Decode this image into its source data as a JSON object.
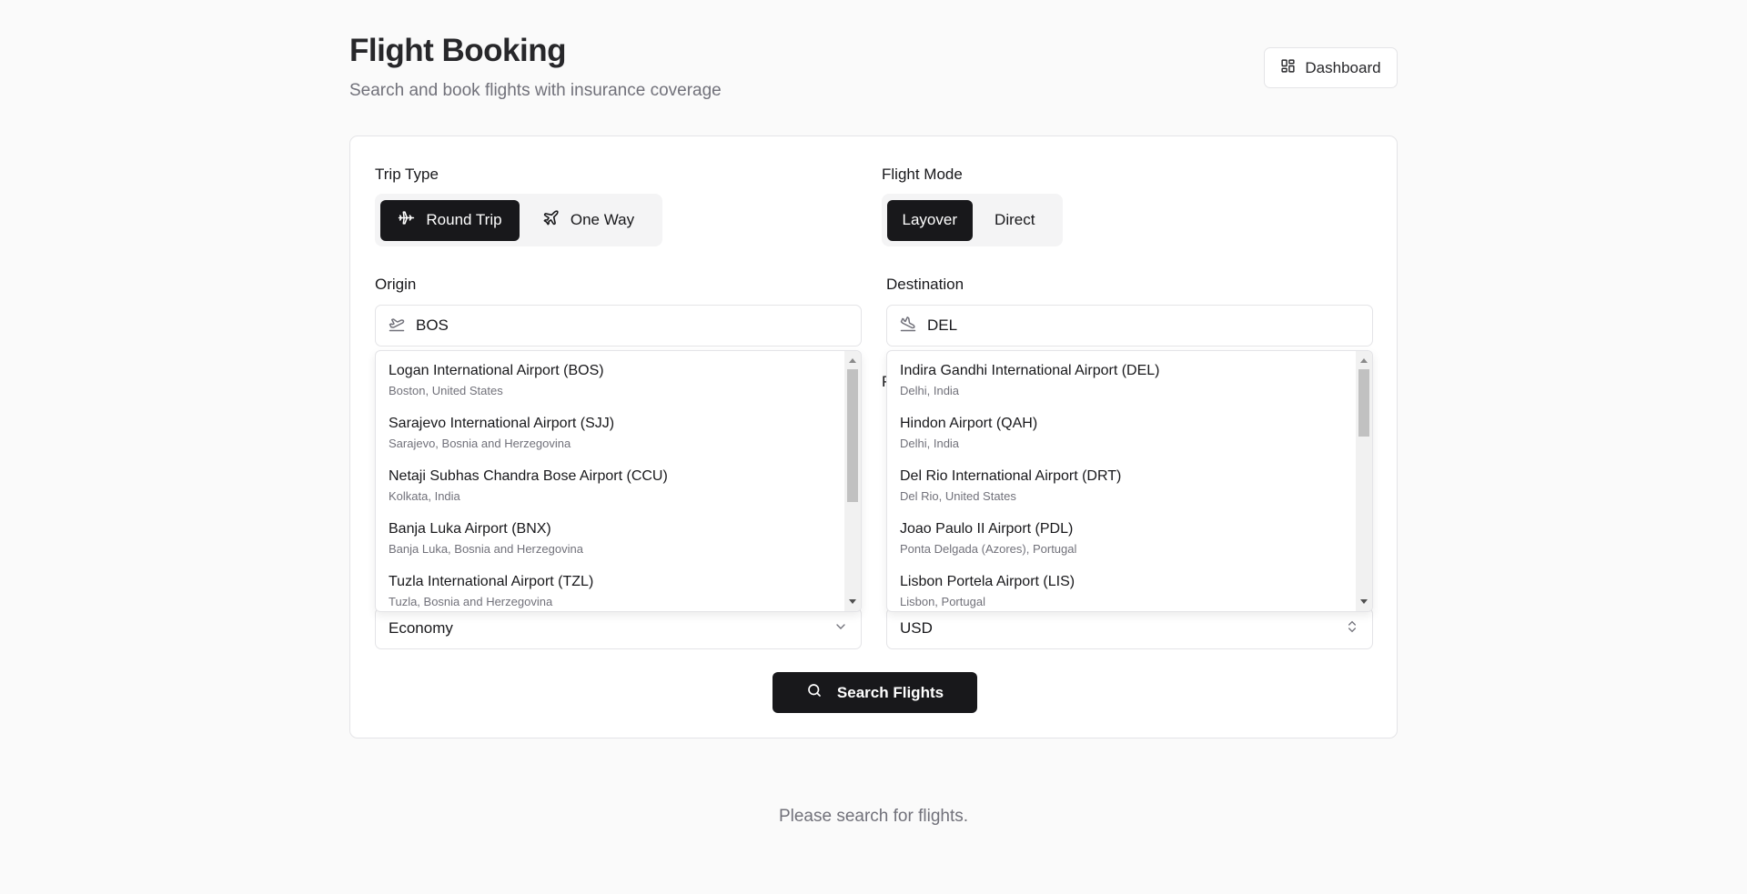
{
  "header": {
    "title": "Flight Booking",
    "subtitle": "Search and book flights with insurance coverage",
    "dashboard_label": "Dashboard"
  },
  "trip_type": {
    "label": "Trip Type",
    "options": [
      {
        "label": "Round Trip",
        "icon": "plane-round-trip-icon",
        "selected": true
      },
      {
        "label": "One Way",
        "icon": "plane-icon",
        "selected": false
      }
    ]
  },
  "flight_mode": {
    "label": "Flight Mode",
    "options": [
      {
        "label": "Layover",
        "selected": true
      },
      {
        "label": "Direct",
        "selected": false
      }
    ]
  },
  "origin": {
    "label": "Origin",
    "value": "BOS",
    "icon": "plane-takeoff-icon",
    "suggestions": [
      {
        "name": "Logan International Airport (BOS)",
        "location": "Boston, United States"
      },
      {
        "name": "Sarajevo International Airport (SJJ)",
        "location": "Sarajevo, Bosnia and Herzegovina"
      },
      {
        "name": "Netaji Subhas Chandra Bose Airport (CCU)",
        "location": "Kolkata, India"
      },
      {
        "name": "Banja Luka Airport (BNX)",
        "location": "Banja Luka, Bosnia and Herzegovina"
      },
      {
        "name": "Tuzla International Airport (TZL)",
        "location": "Tuzla, Bosnia and Herzegovina"
      }
    ]
  },
  "destination": {
    "label": "Destination",
    "value": "DEL",
    "icon": "plane-landing-icon",
    "suggestions": [
      {
        "name": "Indira Gandhi International Airport (DEL)",
        "location": "Delhi, India"
      },
      {
        "name": "Hindon Airport (QAH)",
        "location": "Delhi, India"
      },
      {
        "name": "Del Rio International Airport (DRT)",
        "location": "Del Rio, United States"
      },
      {
        "name": "Joao Paulo II Airport (PDL)",
        "location": "Ponta Delgada (Azores), Portugal"
      },
      {
        "name": "Lisbon Portela Airport (LIS)",
        "location": "Lisbon, Portugal"
      }
    ]
  },
  "cabin_class": {
    "value": "Economy",
    "icon": "chevron-down-icon"
  },
  "currency": {
    "value": "USD",
    "icon": "chevron-up-down-icon"
  },
  "search_button": {
    "label": "Search Flights",
    "icon": "search-icon"
  },
  "results": {
    "empty_message": "Please search for flights."
  },
  "partial_label_fragment": "P"
}
